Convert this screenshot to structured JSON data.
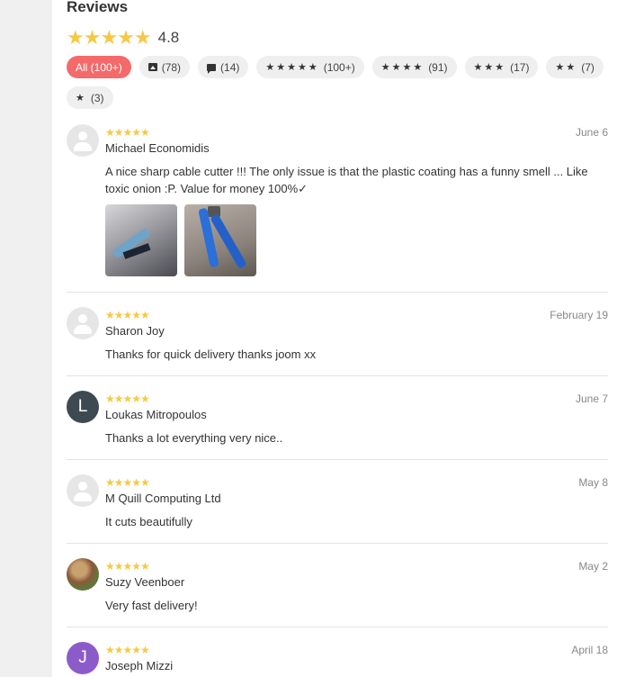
{
  "header": {
    "title": "Reviews",
    "rating": "4.8",
    "star_color": "#f6c945"
  },
  "filters": [
    {
      "label": "All (100+)",
      "icon": "none",
      "active": true
    },
    {
      "label": "(78)",
      "icon": "image-icon"
    },
    {
      "label": "(14)",
      "icon": "comment-icon"
    },
    {
      "label": "(100+)",
      "icon": "star-icon",
      "stars": 5
    },
    {
      "label": "(91)",
      "icon": "star-icon",
      "stars": 4
    },
    {
      "label": "(17)",
      "icon": "star-icon",
      "stars": 3
    },
    {
      "label": "(7)",
      "icon": "star-icon",
      "stars": 2
    },
    {
      "label": "(3)",
      "icon": "star-icon",
      "stars": 1
    }
  ],
  "reviews": [
    {
      "name": "Michael Economidis",
      "date": "June 6",
      "rating": 5,
      "avatar": "default-avatar-icon",
      "text": "A nice sharp cable cutter !!! The only issue is that the plastic coating has a funny smell ... Like toxic onion :P. Value for money 100%✓"
    },
    {
      "name": "Sharon Joy",
      "date": "February 19",
      "rating": 5,
      "avatar": "default-avatar-icon",
      "text": "Thanks for quick delivery thanks joom xx"
    },
    {
      "name": "Loukas Mitropoulos",
      "date": "June 7",
      "rating": 5,
      "avatar_letter": "L",
      "avatar_color": "#3d4a52",
      "text": "Thanks a lot everything very nice.."
    },
    {
      "name": "M Quill Computing Ltd",
      "date": "May 8",
      "rating": 5,
      "avatar": "default-avatar-icon",
      "text": "It cuts beautifully"
    },
    {
      "name": "Suzy Veenboer",
      "date": "May 2",
      "rating": 5,
      "avatar": "photo-avatar",
      "text": "Very fast delivery!"
    },
    {
      "name": "Joseph Mizzi",
      "date": "April 18",
      "rating": 5,
      "avatar_letter": "J",
      "avatar_color": "#8b5cc9",
      "text": ""
    }
  ]
}
